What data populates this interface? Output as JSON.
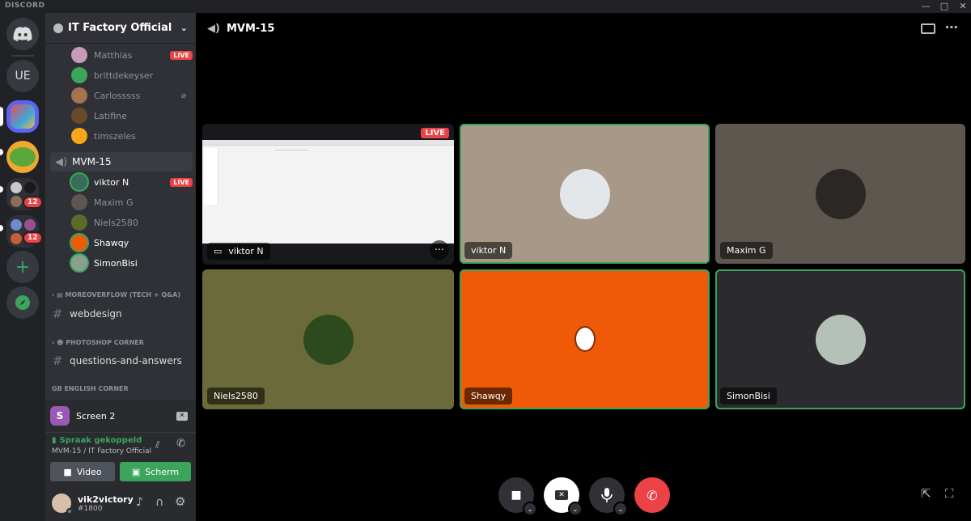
{
  "titlebar": {
    "brand": "DISCORD"
  },
  "guilds": {
    "user_initials": "UE",
    "badge_a": "12",
    "badge_b": "12"
  },
  "server": {
    "name": "IT Factory Official"
  },
  "voice_members_top": [
    {
      "name": "Matthias",
      "live": "LIVE"
    },
    {
      "name": "brittdekeyser"
    },
    {
      "name": "Carlosssss"
    },
    {
      "name": "Latifine"
    },
    {
      "name": "timszeles"
    }
  ],
  "active_voice_channel": {
    "name": "MVM-15"
  },
  "voice_members_active": [
    {
      "name": "viktor N",
      "live": "LIVE"
    },
    {
      "name": "Maxim G"
    },
    {
      "name": "Niels2580"
    },
    {
      "name": "Shawqy"
    },
    {
      "name": "SimonBisi"
    }
  ],
  "categories": [
    {
      "label": "MOREOVERFLOW (TECH + Q&A)",
      "channel": "webdesign"
    },
    {
      "label": "PHOTOSHOP CORNER",
      "channel": "questions-and-answers"
    },
    {
      "label": "ENGLISH CORNER",
      "prefix": "GB"
    }
  ],
  "screen_share": {
    "label": "Screen 2",
    "initial": "S"
  },
  "voice_status": {
    "connected": "Spraak gekoppeld",
    "location": "MVM-15 / IT Factory Official",
    "video_label": "Video",
    "screen_label": "Scherm"
  },
  "user": {
    "name": "vik2victory",
    "tag": "#1800"
  },
  "call": {
    "title": "MVM-15",
    "stream_badge": "LIVE",
    "tiles": [
      {
        "name": "viktor N"
      },
      {
        "name": "viktor N"
      },
      {
        "name": "Maxim G"
      },
      {
        "name": "Niels2580"
      },
      {
        "name": "Shawqy"
      },
      {
        "name": "SimonBisi"
      }
    ]
  },
  "colors": {
    "green": "#3ba55c",
    "red": "#ed4245",
    "blurple": "#5865f2",
    "orange": "#ee5a07",
    "olive": "#6b6a3a"
  }
}
